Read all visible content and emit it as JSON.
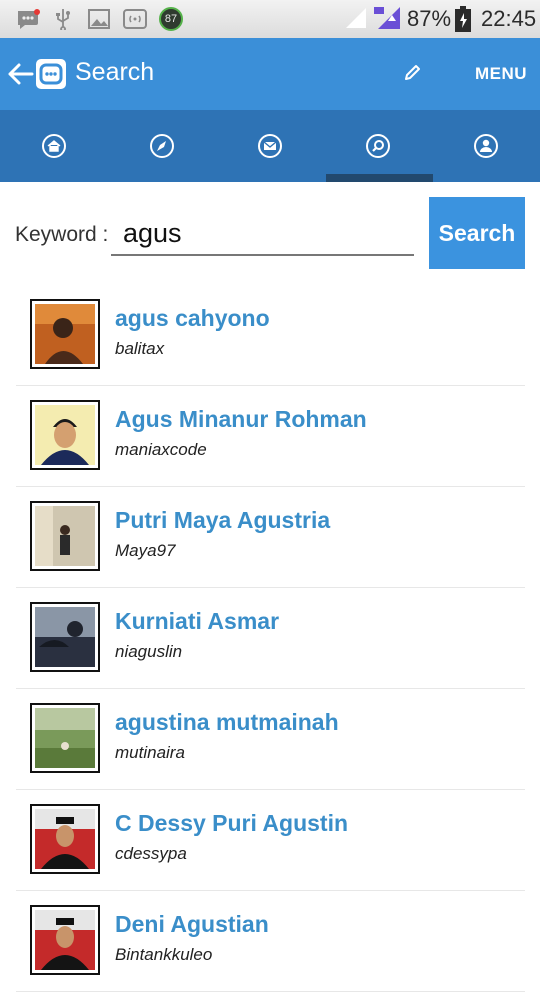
{
  "status_bar": {
    "battery": "87%",
    "time": "22:45",
    "badge_number": "87",
    "icons": [
      "bbm-icon",
      "usb-icon",
      "image-icon",
      "wifi-box-icon",
      "notification-badge",
      "signal-icon",
      "signal-icon-2",
      "battery-icon"
    ]
  },
  "app_bar": {
    "title": "Search",
    "menu_label": "MENU",
    "icons": [
      "back-arrow-icon",
      "app-logo-icon",
      "pencil-icon"
    ]
  },
  "tabs": [
    {
      "icon": "home-icon"
    },
    {
      "icon": "rocket-icon"
    },
    {
      "icon": "mail-icon"
    },
    {
      "icon": "search-icon",
      "active": true
    },
    {
      "icon": "profile-icon"
    }
  ],
  "search": {
    "label": "Keyword :",
    "value": "agus",
    "button_label": "Search"
  },
  "results": [
    {
      "name": "agus cahyono",
      "username": "balitax"
    },
    {
      "name": "Agus Minanur Rohman",
      "username": "maniaxcode"
    },
    {
      "name": "Putri Maya Agustria",
      "username": "Maya97"
    },
    {
      "name": "Kurniati Asmar",
      "username": "niaguslin"
    },
    {
      "name": "agustina mutmainah",
      "username": "mutinaira"
    },
    {
      "name": "C Dessy Puri Agustin",
      "username": "cdessypa"
    },
    {
      "name": "Deni Agustian",
      "username": "Bintankkuleo"
    }
  ],
  "colors": {
    "app_bar": "#3b8fd8",
    "tab_bar": "#2e73b5",
    "tab_indicator": "#22496e",
    "search_button": "#3b93df",
    "result_name": "#3a8ec9"
  }
}
